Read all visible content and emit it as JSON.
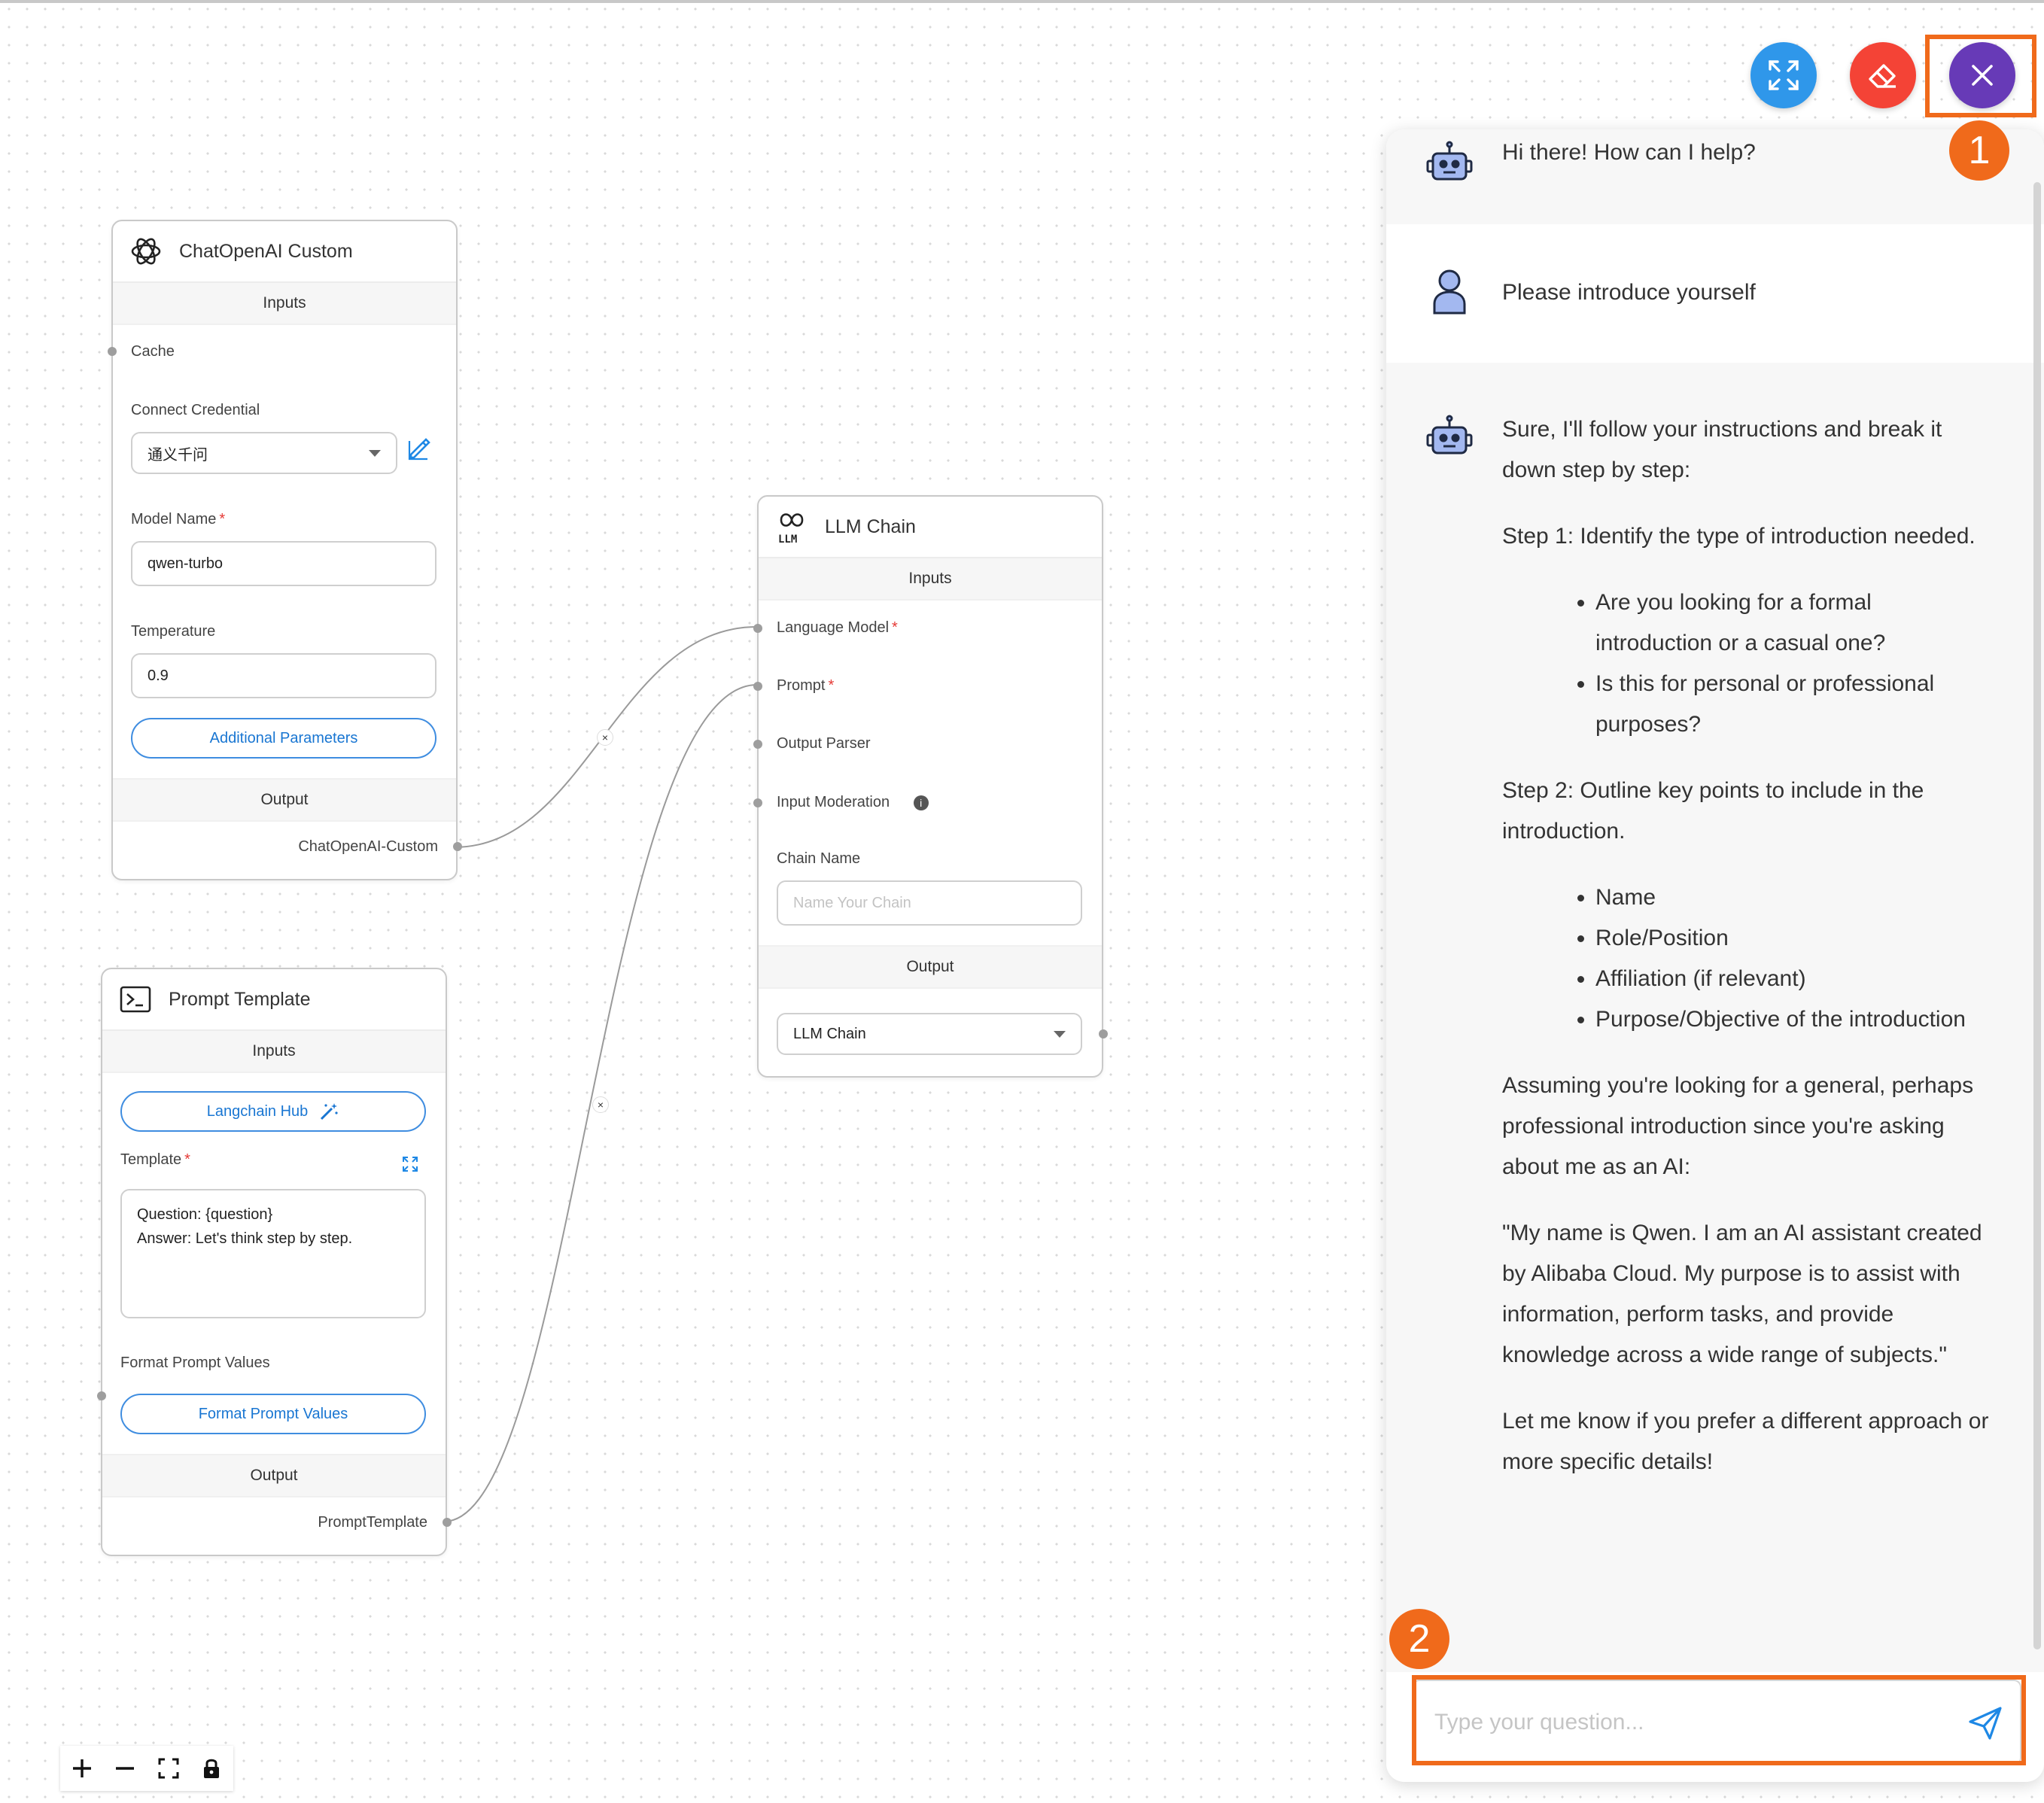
{
  "nodes": {
    "chatopenai": {
      "title": "ChatOpenAI Custom",
      "inputs_label": "Inputs",
      "cache_label": "Cache",
      "credential_label": "Connect Credential",
      "credential_value": "通义千问",
      "model_name_label": "Model Name",
      "model_name_value": "qwen-turbo",
      "temperature_label": "Temperature",
      "temperature_value": "0.9",
      "additional_params_label": "Additional Parameters",
      "output_label": "Output",
      "output_value": "ChatOpenAI-Custom"
    },
    "prompt_template": {
      "title": "Prompt Template",
      "inputs_label": "Inputs",
      "langchain_hub_label": "Langchain Hub",
      "template_label": "Template",
      "template_line1": "Question: {question}",
      "template_line2": "Answer: Let's think step by step.",
      "format_values_label": "Format Prompt Values",
      "format_values_button": "Format Prompt Values",
      "output_label": "Output",
      "output_value": "PromptTemplate"
    },
    "llm_chain": {
      "title": "LLM Chain",
      "inputs_label": "Inputs",
      "language_model_label": "Language Model",
      "prompt_label": "Prompt",
      "output_parser_label": "Output Parser",
      "input_moderation_label": "Input Moderation",
      "chain_name_label": "Chain Name",
      "chain_name_placeholder": "Name Your Chain",
      "output_label": "Output",
      "output_value": "LLM Chain"
    }
  },
  "chat": {
    "greeting": "Hi there! How can I help?",
    "user_message": "Please introduce yourself",
    "response": {
      "p1": "Sure, I'll follow your instructions and break it down step by step:",
      "step1": "Step 1: Identify the type of introduction needed.",
      "step1_items": [
        "Are you looking for a formal introduction or a casual one?",
        "Is this for personal or professional purposes?"
      ],
      "step2": "Step 2: Outline key points to include in the introduction.",
      "step2_items": [
        "Name",
        "Role/Position",
        "Affiliation (if relevant)",
        "Purpose/Objective of the introduction"
      ],
      "p2": "Assuming you're looking for a general, perhaps professional introduction since you're asking about me as an AI:",
      "p3": "\"My name is Qwen. I am an AI assistant created by Alibaba Cloud. My purpose is to assist with information, perform tasks, and provide knowledge across a wide range of subjects.\"",
      "p4": "Let me know if you prefer a different approach or more specific details!"
    },
    "input_placeholder": "Type your question..."
  },
  "annotations": {
    "badge1": "1",
    "badge2": "2"
  },
  "colors": {
    "expand_button": "#2f97ea",
    "clear_button": "#f44336",
    "close_button": "#673ab7",
    "annotation": "#f06a1b",
    "link_blue": "#1976d2"
  },
  "icons": [
    "openai-logo-icon",
    "llm-logo-icon",
    "terminal-icon",
    "edit-icon",
    "magic-wand-icon",
    "expand-icon",
    "info-icon",
    "robot-icon",
    "user-icon",
    "send-icon",
    "eraser-icon",
    "close-icon",
    "plus-icon",
    "minus-icon",
    "fit-view-icon",
    "lock-icon"
  ]
}
